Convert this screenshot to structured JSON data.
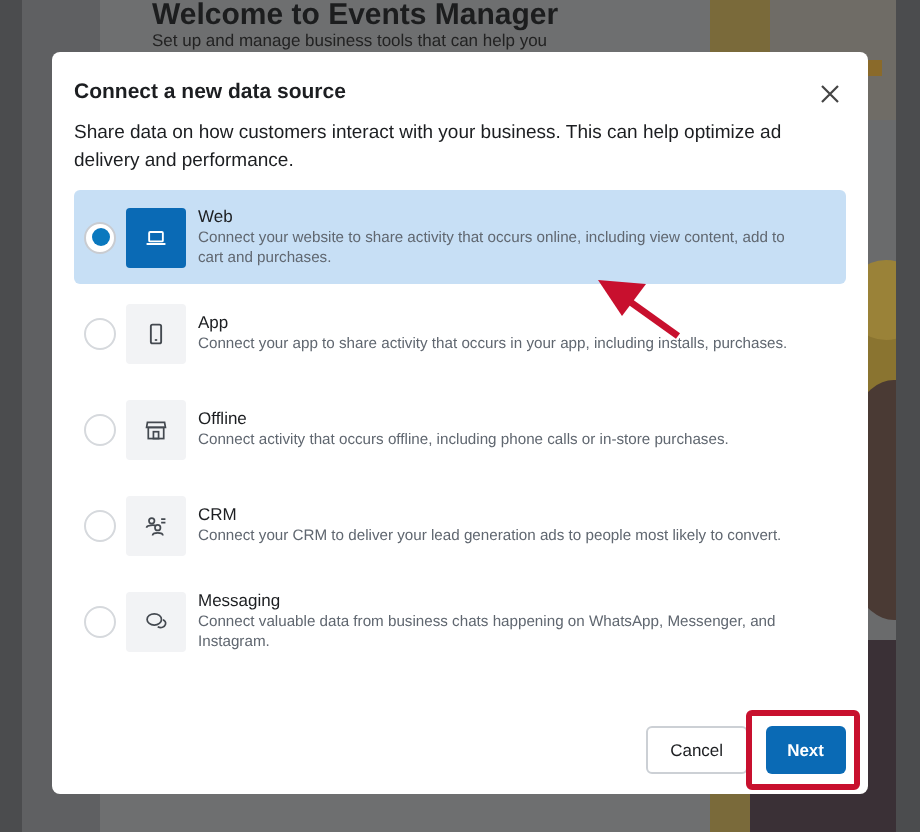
{
  "background_page": {
    "title": "Welcome to Events Manager",
    "subtitle": "Set up and manage business tools that can help you"
  },
  "dialog": {
    "title": "Connect a new data source",
    "description": "Share data on how customers interact with your business. This can help optimize ad delivery and performance.",
    "options": [
      {
        "kind": "web",
        "label": "Web",
        "description": "Connect your website to share activity that occurs online, including view content, add to cart and purchases.",
        "selected": true
      },
      {
        "kind": "app",
        "label": "App",
        "description": "Connect your app to share activity that occurs in your app, including installs, purchases.",
        "selected": false
      },
      {
        "kind": "offline",
        "label": "Offline",
        "description": "Connect activity that occurs offline, including phone calls or in-store purchases.",
        "selected": false
      },
      {
        "kind": "crm",
        "label": "CRM",
        "description": "Connect your CRM to deliver your lead generation ads to people most likely to convert.",
        "selected": false
      },
      {
        "kind": "messaging",
        "label": "Messaging",
        "description": "Connect valuable data from business chats happening on WhatsApp, Messenger, and Instagram.",
        "selected": false
      }
    ],
    "buttons": [
      {
        "kind": "secondary",
        "label": "Cancel"
      },
      {
        "kind": "primary",
        "label": "Next"
      }
    ]
  }
}
